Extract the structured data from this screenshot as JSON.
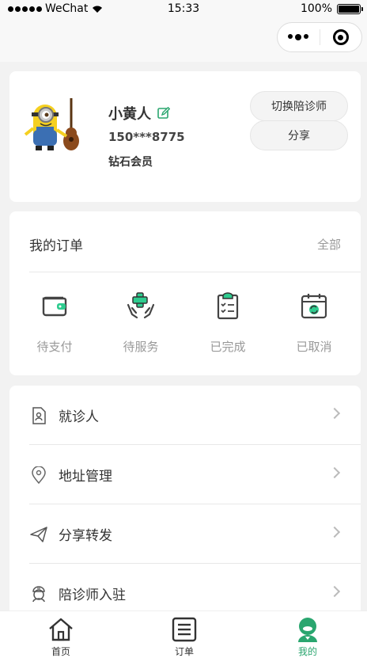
{
  "status_bar": {
    "carrier": "WeChat",
    "time": "15:33",
    "battery": "100%"
  },
  "profile": {
    "name": "小黄人",
    "phone": "150***8775",
    "member_level": "钻石会员",
    "switch_label": "切换陪诊师",
    "share_label": "分享"
  },
  "orders": {
    "title": "我的订单",
    "all_label": "全部",
    "items": [
      {
        "label": "待支付",
        "icon": "wallet-icon"
      },
      {
        "label": "待服务",
        "icon": "care-hands-icon"
      },
      {
        "label": "已完成",
        "icon": "checklist-icon"
      },
      {
        "label": "已取消",
        "icon": "calendar-refresh-icon"
      }
    ]
  },
  "menu": {
    "items": [
      {
        "label": "就诊人",
        "icon": "patient-card-icon"
      },
      {
        "label": "地址管理",
        "icon": "location-pin-icon"
      },
      {
        "label": "分享转发",
        "icon": "paper-plane-icon"
      },
      {
        "label": "陪诊师入驻",
        "icon": "nurse-icon"
      }
    ]
  },
  "tabbar": {
    "items": [
      {
        "label": "首页",
        "icon": "home-icon"
      },
      {
        "label": "订单",
        "icon": "order-list-icon"
      },
      {
        "label": "我的",
        "icon": "user-icon"
      }
    ],
    "active_color": "#2aa66f"
  },
  "colors": {
    "accent": "#2aa66f",
    "background": "#f2f2f2"
  }
}
